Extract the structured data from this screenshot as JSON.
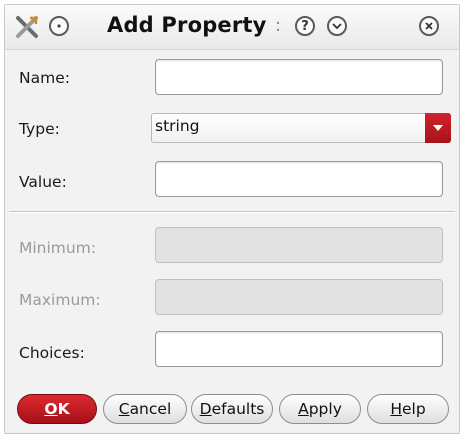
{
  "window": {
    "title": "Add Property",
    "title_separator": ":"
  },
  "titlebar": {
    "menu_icon": "x-tools-icon",
    "minimize_icon": "circle-dot-icon",
    "help_glyph": "?",
    "collapse_icon": "chevron-down-circle-icon",
    "close_icon": "close-circle-icon"
  },
  "form": {
    "name": {
      "label": "Name:",
      "value": ""
    },
    "type": {
      "label": "Type:",
      "value": "string"
    },
    "value": {
      "label": "Value:",
      "value": ""
    },
    "minimum": {
      "label": "Minimum:",
      "value": "",
      "disabled": true
    },
    "maximum": {
      "label": "Maximum:",
      "value": "",
      "disabled": true
    },
    "choices": {
      "label": "Choices:",
      "value": ""
    }
  },
  "buttons": {
    "ok": {
      "mnemonic": "O",
      "rest": "K"
    },
    "cancel": {
      "mnemonic": "C",
      "rest": "ancel"
    },
    "defaults": {
      "mnemonic": "D",
      "rest": "efaults"
    },
    "apply": {
      "mnemonic": "A",
      "rest": "pply"
    },
    "help": {
      "mnemonic": "H",
      "rest": "elp"
    }
  },
  "colors": {
    "accent": "#c01820",
    "disabled_field": "#e2e2e2",
    "disabled_label": "#9a9a9a"
  }
}
